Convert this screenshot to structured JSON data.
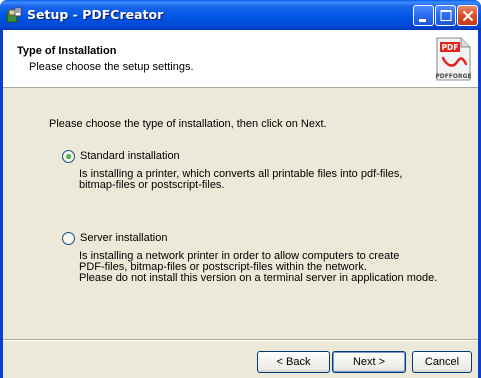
{
  "window": {
    "title": "Setup - PDFCreator"
  },
  "header": {
    "title": "Type of Installation",
    "subtitle": "Please choose the setup settings.",
    "logo_badge": "PDF",
    "logo_text": "PDFFORGE"
  },
  "main": {
    "instruction": "Please choose the type of installation, then click on Next.",
    "options": [
      {
        "label": "Standard installation",
        "selected": true,
        "description": [
          "Is installing a printer, which converts all printable files into pdf-files,",
          "bitmap-files or postscript-files."
        ]
      },
      {
        "label": "Server installation",
        "selected": false,
        "description": [
          "Is installing a network printer in order to allow computers to create",
          "PDF-files, bitmap-files or postscript-files within the network.",
          "Please do not install this version on a terminal server in application mode."
        ]
      }
    ]
  },
  "footer": {
    "back_label": "< Back",
    "next_label": "Next >",
    "cancel_label": "Cancel"
  },
  "colors": {
    "titlebar": "#0055e5",
    "client_bg": "#ece9d8",
    "header_bg": "#ffffff",
    "close_button": "#d9532f",
    "radio_dot": "#2b9e22",
    "logo_red": "#e2231a"
  },
  "icons": {
    "app": "setup-box-icon",
    "minimize": "minimize-icon",
    "maximize": "maximize-icon",
    "close": "close-icon",
    "logo": "pdfforge-logo-icon"
  }
}
